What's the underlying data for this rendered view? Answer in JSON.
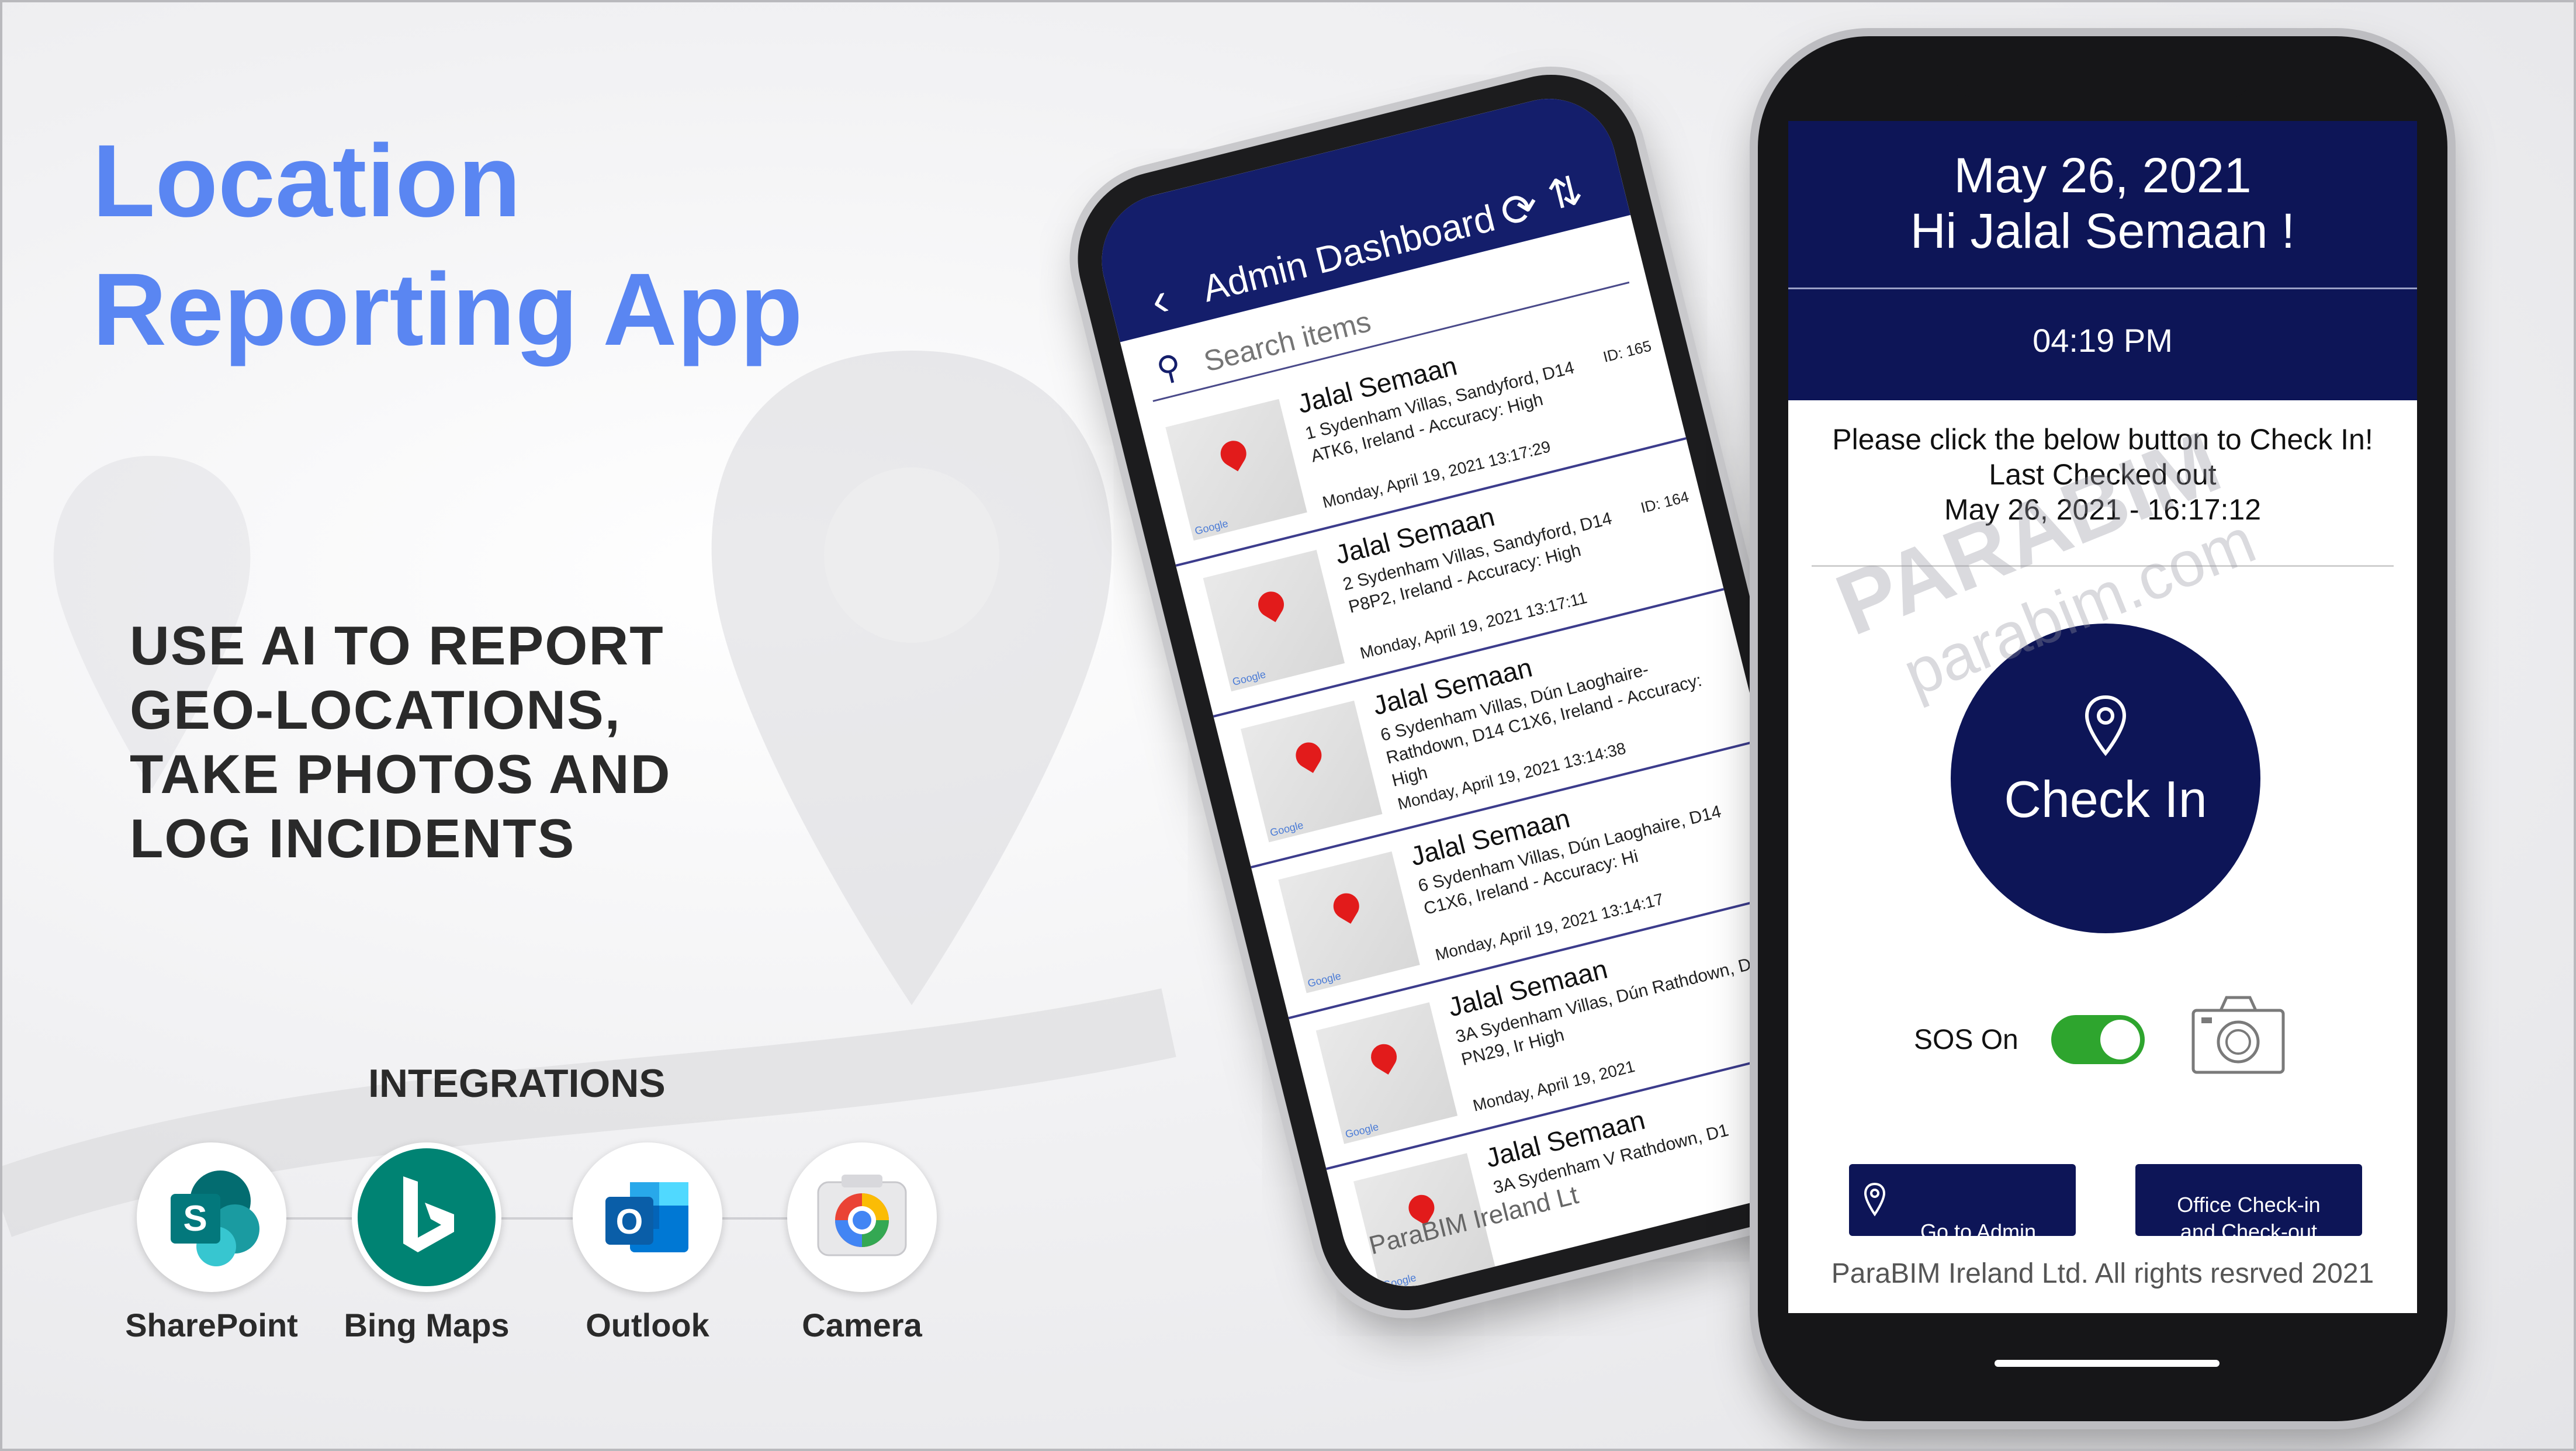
{
  "title": "Location\nReporting App",
  "tagline": "USE AI TO REPORT\nGEO-LOCATIONS,\nTAKE PHOTOS AND\nLOG INCIDENTS",
  "integrations": {
    "heading": "INTEGRATIONS",
    "items": [
      {
        "label": "SharePoint",
        "icon": "sharepoint-icon"
      },
      {
        "label": "Bing Maps",
        "icon": "bing-maps-icon"
      },
      {
        "label": "Outlook",
        "icon": "outlook-icon"
      },
      {
        "label": "Camera",
        "icon": "camera-icon"
      }
    ]
  },
  "admin_app": {
    "title": "Admin Dashboard",
    "search_placeholder": "Search items",
    "rows": [
      {
        "name": "Jalal Semaan",
        "address": "1 Sydenham Villas, Sandyford, D14 ATK6, Ireland - Accuracy: High",
        "id": "ID: 165",
        "date": "Monday, April 19, 2021 13:17:29"
      },
      {
        "name": "Jalal Semaan",
        "address": "2 Sydenham Villas, Sandyford, D14 P8P2, Ireland - Accuracy: High",
        "id": "ID: 164",
        "date": "Monday, April 19, 2021 13:17:11"
      },
      {
        "name": "Jalal Semaan",
        "address": "6 Sydenham Villas, Dún Laoghaire-Rathdown, D14 C1X6, Ireland - Accuracy: High",
        "id": "",
        "date": "Monday, April 19, 2021 13:14:38"
      },
      {
        "name": "Jalal Semaan",
        "address": "6 Sydenham Villas, Dún Laoghaire, D14 C1X6, Ireland - Accuracy: Hi",
        "id": "",
        "date": "Monday, April 19, 2021 13:14:17"
      },
      {
        "name": "Jalal Semaan",
        "address": "3A Sydenham Villas, Dún Rathdown, D14 PN29, Ir High",
        "id": "",
        "date": "Monday, April 19, 2021"
      },
      {
        "name": "Jalal Semaan",
        "address": "3A Sydenham V Rathdown, D1",
        "id": "",
        "date": ""
      }
    ],
    "footer": "ParaBIM Ireland Lt"
  },
  "checkin_app": {
    "date": "May 26, 2021",
    "greeting": "Hi Jalal Semaan !",
    "time": "04:19 PM",
    "message": "Please click the below button to Check In!",
    "last_checked_label": "Last Checked out",
    "last_checked_value": "May 26, 2021 - 16:17:12",
    "checkin_label": "Check In",
    "sos_label": "SOS On",
    "sos_on": true,
    "admin_button": "Go to Admin\nDashboard",
    "office_button": "Office Check-in\nand Check-out",
    "copyright": "ParaBIM Ireland Ltd. All rights resrved 2021"
  },
  "watermark": {
    "brand": "PARABIM",
    "site": "parabim.com"
  },
  "colors": {
    "title": "#5a86f2",
    "navy": "#0d1557",
    "admin_navy": "#141e6b",
    "toggle": "#2ea52e",
    "pin": "#e21b1b"
  }
}
